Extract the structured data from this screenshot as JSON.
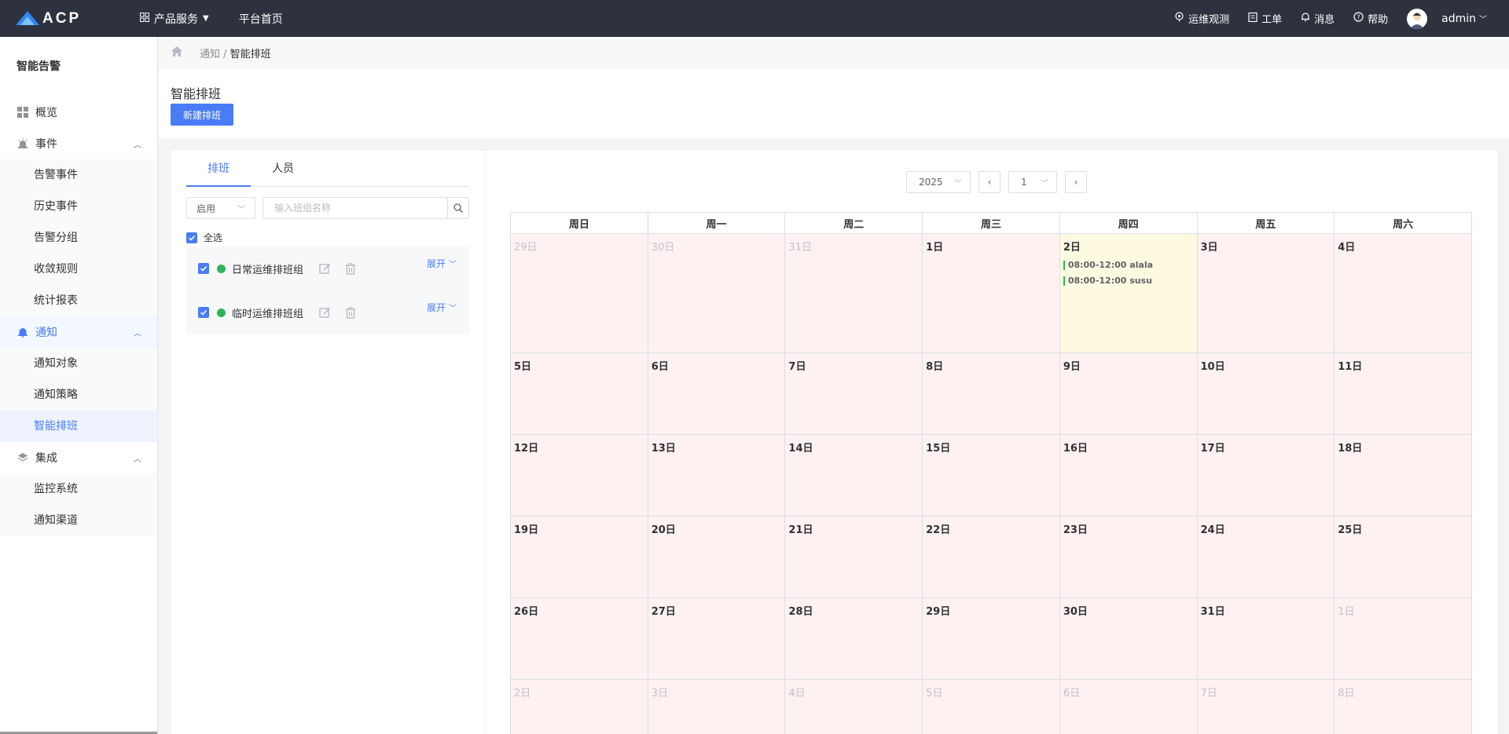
{
  "topbar": {
    "logo_text": "ACP",
    "nav": [
      {
        "label": "产品服务"
      },
      {
        "label": "平台首页"
      }
    ],
    "right": [
      {
        "label": "运维观测"
      },
      {
        "label": "工单"
      },
      {
        "label": "消息"
      },
      {
        "label": "帮助"
      }
    ],
    "user": "admin"
  },
  "sidebar": {
    "title": "智能告警",
    "overview": "概览",
    "groups": [
      {
        "label": "事件",
        "items": [
          "告警事件",
          "历史事件",
          "告警分组",
          "收敛规则",
          "统计报表"
        ]
      },
      {
        "label": "通知",
        "items": [
          "通知对象",
          "通知策略",
          "智能排班"
        ]
      },
      {
        "label": "集成",
        "items": [
          "监控系统",
          "通知渠道"
        ]
      }
    ]
  },
  "breadcrumb": {
    "parent": "通知 /",
    "current": "智能排班"
  },
  "page": {
    "title": "智能排班",
    "new_button": "新建排班"
  },
  "left": {
    "tabs": [
      "排班",
      "人员"
    ],
    "status_filter": "启用",
    "search_placeholder": "输入班组名称",
    "check_all": "全选",
    "expand_label": "展开",
    "groups": [
      "日常运维排班组",
      "临时运维排班组"
    ]
  },
  "calendar": {
    "year": "2025",
    "month": "1",
    "weekdays": [
      "周日",
      "周一",
      "周二",
      "周三",
      "周四",
      "周五",
      "周六"
    ],
    "weeks": [
      [
        "29日",
        "30日",
        "31日",
        "1日",
        "2日",
        "3日",
        "4日"
      ],
      [
        "5日",
        "6日",
        "7日",
        "8日",
        "9日",
        "10日",
        "11日"
      ],
      [
        "12日",
        "13日",
        "14日",
        "15日",
        "16日",
        "17日",
        "18日"
      ],
      [
        "19日",
        "20日",
        "21日",
        "22日",
        "23日",
        "24日",
        "25日"
      ],
      [
        "26日",
        "27日",
        "28日",
        "29日",
        "30日",
        "31日",
        "1日"
      ],
      [
        "2日",
        "3日",
        "4日",
        "5日",
        "6日",
        "7日",
        "8日"
      ]
    ],
    "events": [
      "08:00-12:00 alala",
      "08:00-12:00 susu"
    ]
  },
  "colors": {
    "accent": "#4a7cf6",
    "topbar": "#2e323f",
    "status_green": "#2fb35a",
    "cell_bg": "#fef1f1",
    "today_bg": "#fefae2"
  }
}
